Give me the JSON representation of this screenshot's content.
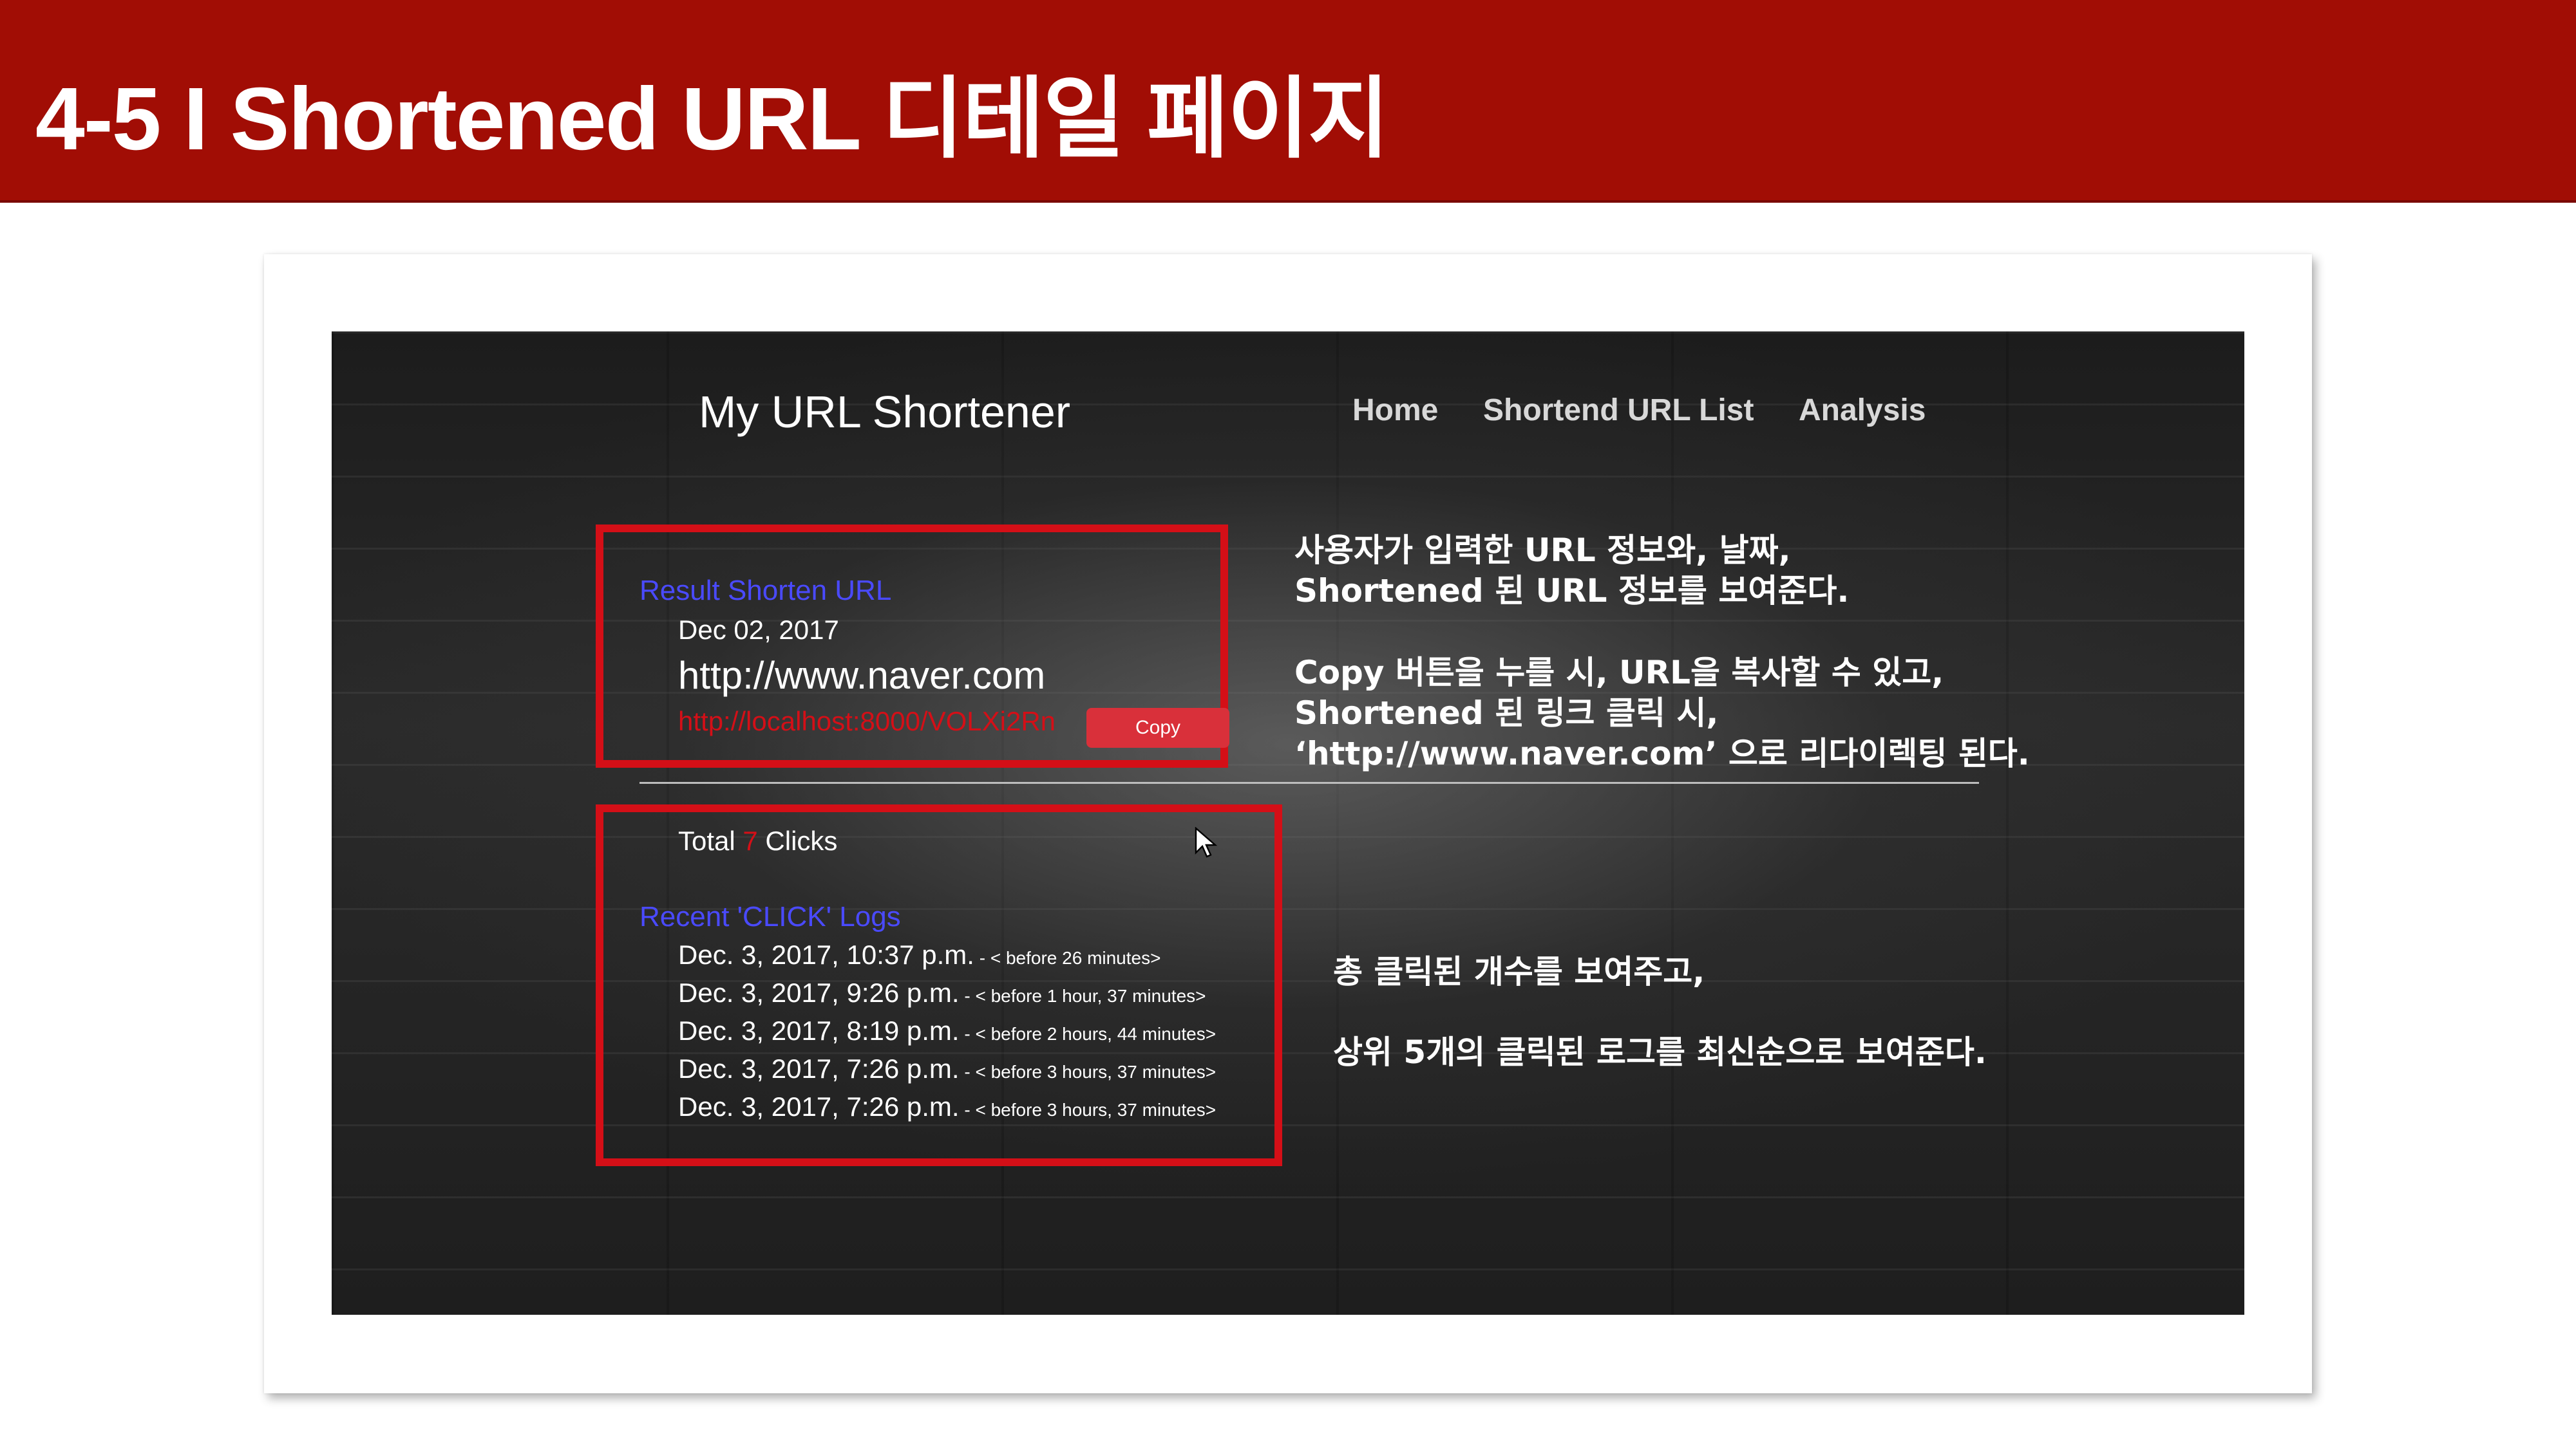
{
  "slide": {
    "title": "4-5 I Shortened URL 디테일 페이지"
  },
  "app": {
    "brand": "My URL Shortener",
    "nav": {
      "home": "Home",
      "list": "Shortend URL List",
      "analysis": "Analysis"
    }
  },
  "result": {
    "title": "Result Shorten URL",
    "date": "Dec 02, 2017",
    "original_url": "http://www.naver.com",
    "short_url": "http://localhost:8000/VOLXi2Rn",
    "copy_label": "Copy"
  },
  "clicks": {
    "total_prefix": "Total",
    "total_count": "7",
    "total_suffix": "Clicks",
    "logs_title": "Recent 'CLICK' Logs",
    "logs": [
      {
        "date": "Dec. 3, 2017, 10:37 p.m.",
        "ago": " - < before 26 minutes>"
      },
      {
        "date": "Dec. 3, 2017, 9:26 p.m.",
        "ago": " - < before 1 hour, 37 minutes>"
      },
      {
        "date": "Dec. 3, 2017, 8:19 p.m.",
        "ago": " - < before 2 hours, 44 minutes>"
      },
      {
        "date": "Dec. 3, 2017, 7:26 p.m.",
        "ago": " - < before 3 hours, 37 minutes>"
      },
      {
        "date": "Dec. 3, 2017, 7:26 p.m.",
        "ago": " - < before 3 hours, 37 minutes>"
      }
    ]
  },
  "descriptions": {
    "top": [
      "사용자가 입력한 URL 정보와, 날짜,",
      "Shortened 된 URL 정보를 보여준다.",
      "Copy 버튼을 누를 시, URL을 복사할 수 있고,",
      "Shortened 된 링크 클릭 시,",
      "‘http://www.naver.com’ 으로 리다이렉팅 된다."
    ],
    "bottom": [
      "총 클릭된 개수를 보여주고,",
      "상위 5개의 클릭된 로그를 최신순으로 보여준다."
    ]
  },
  "colors": {
    "header_bg": "#a10d05",
    "highlight_box": "#d40f17",
    "link_blue": "#4a4aff",
    "copy_button": "#d9303a"
  }
}
